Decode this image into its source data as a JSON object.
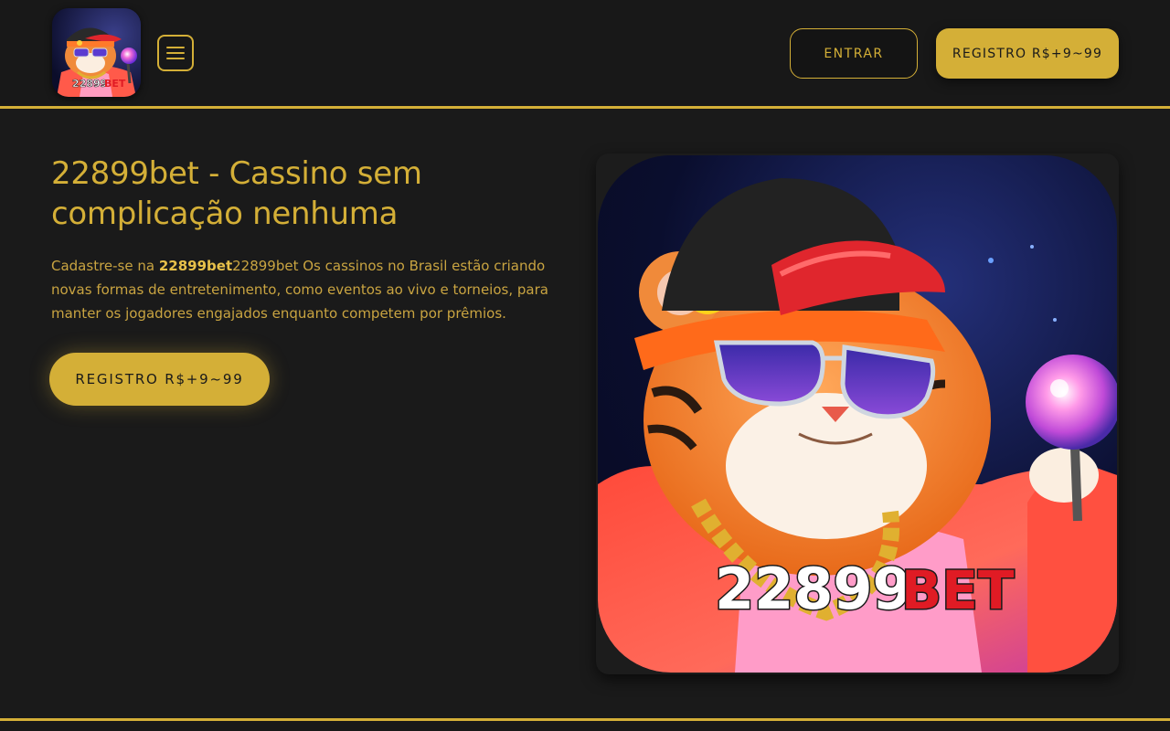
{
  "header": {
    "logo_text_number": "22899",
    "logo_text_brand": "BET",
    "menu_icon": "hamburger-menu-icon",
    "login_label": "ENTRAR",
    "register_label": "REGISTRO R$+9~99"
  },
  "hero": {
    "title": "22899bet - Cassino sem complicação nenhuma",
    "description_prefix": "Cadastre-se na ",
    "description_bold": "22899bet",
    "description_rest": "22899bet Os cassinos no Brasil estão criando novas formas de entretenimento, como eventos ao vivo e torneios, para manter os jogadores engajados enquanto competem por prêmios.",
    "cta_label": "REGISTRO R$+9~99",
    "image_text_number": "22899",
    "image_text_brand": "BET"
  },
  "colors": {
    "background": "#1a1a1a",
    "accent_gold": "#d4af37",
    "brand_red": "#e01b24"
  }
}
